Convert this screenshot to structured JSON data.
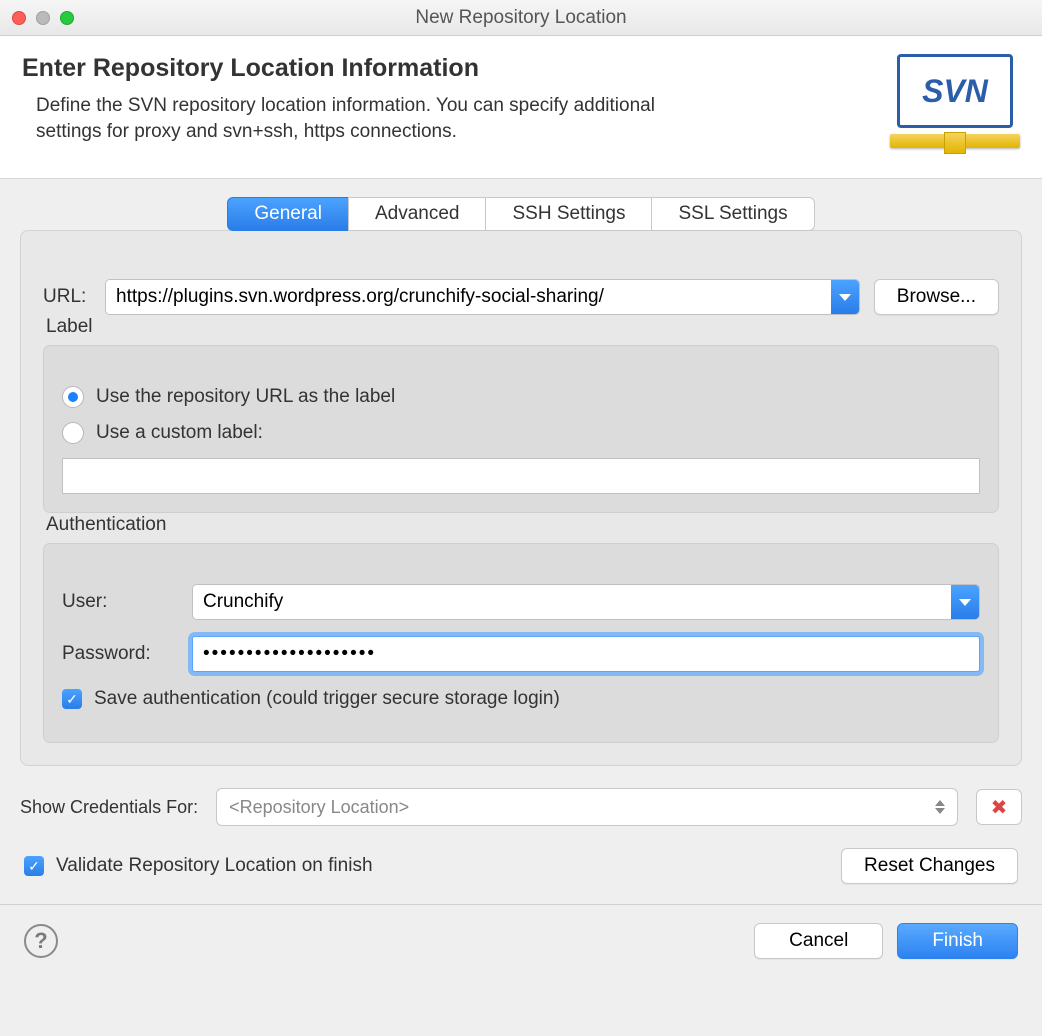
{
  "window": {
    "title": "New Repository Location"
  },
  "header": {
    "title": "Enter Repository Location Information",
    "desc": "Define the SVN repository location information. You can specify additional settings for proxy and svn+ssh, https connections.",
    "logo_text": "SVN"
  },
  "tabs": {
    "general": "General",
    "advanced": "Advanced",
    "ssh": "SSH Settings",
    "ssl": "SSL Settings"
  },
  "url": {
    "label": "URL:",
    "value": "https://plugins.svn.wordpress.org/crunchify-social-sharing/",
    "browse": "Browse..."
  },
  "labelGroup": {
    "legend": "Label",
    "opt_url": "Use the repository URL as the label",
    "opt_custom": "Use a custom label:",
    "custom_value": ""
  },
  "auth": {
    "legend": "Authentication",
    "user_label": "User:",
    "user_value": "Crunchify",
    "pw_label": "Password:",
    "pw_value": "••••••••••••••••••••",
    "save": "Save authentication (could trigger secure storage login)"
  },
  "creds": {
    "label": "Show Credentials For:",
    "placeholder": "<Repository Location>"
  },
  "validate": "Validate Repository Location on finish",
  "reset": "Reset Changes",
  "footer": {
    "cancel": "Cancel",
    "finish": "Finish"
  }
}
